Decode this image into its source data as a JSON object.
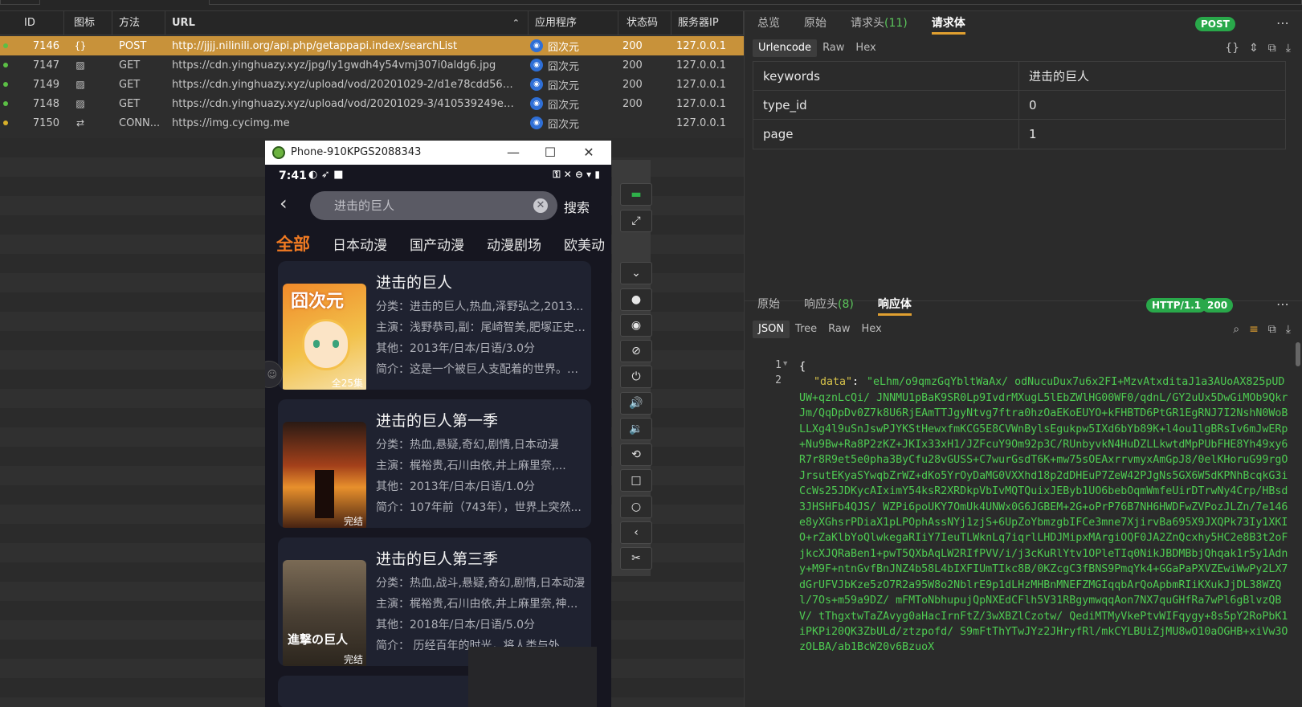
{
  "list": {
    "columns": [
      "ID",
      "图标",
      "方法",
      "URL",
      "应用程序",
      "状态码",
      "服务器IP"
    ],
    "rows": [
      {
        "id": "7146",
        "icon": "{}",
        "method": "POST",
        "url": "http://jjjj.nilinili.org/api.php/getappapi.index/searchList",
        "app": "囧次元",
        "status": "200",
        "ip": "127.0.0.1",
        "dot": "#5bbf45",
        "selected": true
      },
      {
        "id": "7147",
        "icon": "image",
        "method": "GET",
        "url": "https://cdn.yinghuazy.xyz/jpg/ly1gwdh4y54vmj307i0aldg6.jpg",
        "app": "囧次元",
        "status": "200",
        "ip": "127.0.0.1",
        "dot": "#5bbf45"
      },
      {
        "id": "7149",
        "icon": "image",
        "method": "GET",
        "url": "https://cdn.yinghuazy.xyz/upload/vod/20201029-2/d1e78cdd56d65...",
        "app": "囧次元",
        "status": "200",
        "ip": "127.0.0.1",
        "dot": "#5bbf45"
      },
      {
        "id": "7148",
        "icon": "image",
        "method": "GET",
        "url": "https://cdn.yinghuazy.xyz/upload/vod/20201029-3/410539249ec40...",
        "app": "囧次元",
        "status": "200",
        "ip": "127.0.0.1",
        "dot": "#5bbf45"
      },
      {
        "id": "7150",
        "icon": "tunnel",
        "method": "CONN...",
        "url": "https://img.cycimg.me",
        "app": "囧次元",
        "status": "",
        "ip": "127.0.0.1",
        "dot": "#d8b02a"
      }
    ]
  },
  "request": {
    "tabs": [
      "总览",
      "原始",
      "请求头",
      "请求体"
    ],
    "header_count": "(11)",
    "method_badge": "POST",
    "subtabs": [
      "Urlencode",
      "Raw",
      "Hex"
    ],
    "params": [
      {
        "key": "keywords",
        "value": "进击的巨人"
      },
      {
        "key": "type_id",
        "value": "0"
      },
      {
        "key": "page",
        "value": "1"
      }
    ]
  },
  "response": {
    "tabs": [
      "原始",
      "响应头",
      "响应体"
    ],
    "header_count": "(8)",
    "http_badge": "HTTP/1.1",
    "status_badge": "200",
    "subtabs": [
      "JSON",
      "Tree",
      "Raw",
      "Hex"
    ],
    "line1": "1",
    "line2": "2",
    "brace": "{",
    "data_key": "\"data\"",
    "data_value": "\"eLhm/o9qmzGqYbltWaAx/ odNucuDux7u6x2FI+MzvAtxditaJ1a3AUoAX825pUDUW+qznLcQi/ JNNMU1pBaK9SR0Lp9IvdrMXugL5lEbZWlHG00WF0/qdnL/GY2uUx5DwGiMOb9QkrJm/QqDpDv0Z7k8U6RjEAmTTJgyNtvg7ftra0hzOaEKoEUYO+kFHBTD6PtGR1EgRNJ7I2NshN0WoBLLXg4l9uSnJswPJYKStHewxfmKCG5E8CVWnBylsEgukpw5IXd6bYb89K+l4ou1lgBRsIv6mJwERp+Nu9Bw+Ra8P2zKZ+JKIx33xH1/JZFcuY9Om92p3C/RUnbyvkN4HuDZLLkwtdMpPUbFHE8Yh49xy6R7r8R9et5e0pha3ByCfu28vGUSS+C7wurGsdT6K+mw75sOEAxrrvmyxAmGpJ8/0elKHoruG99rgOJrsutEKyaSYwqbZrWZ+dKo5YrOyDaMG0VXXhd18p2dDHEuP7ZeW42PJgNs5GX6W5dKPNhBcqkG3iCcWs25JDKycAIximY54ksR2XRDkpVbIvMQTQuixJEByb1UO6bebOqmWmfeUirDTrwNy4Crp/HBsd3JHSHFb4QJS/ WZPi6poUKY7OmUk4UNWx0G6JGBEM+2G+oPrP76B7NH6HWDFwZVPozJLZn/7e146e8yXGhsrPDiaX1pLPOphAssNYj1zjS+6UpZoYbmzgbIFCe3mne7XjirvBa695X9JXQPk73Iy1XKIO+rZaKlbYoQlwkegaRIiY7IeuTLWknLq7iqrlLHDJMipxMArgiOQF0JA2ZnQcxhy5HC2e8B3t2oFjkcXJQRaBen1+pwT5QXbAqLW2RIfPVV/i/j3cKuRlYtv1OPleTIq0NikJBDMBbjQhqak1r5y1Adny+M9F+ntnGvfBnJNZ4b58L4bIXFIUmTIkc8B/0KZcgC3fBNS9PmqYk4+GGaPaPXVZEwiWwPy2LX7dGrUFVJbKze5zO7R2a95W8o2NblrE9p1dLHzMHBnMNEFZMGIqqbArQoApbmRIiKXukJjDL38WZQl/7Os+m59a9DZ/ mFMToNbhupujQpNXEdCFlh5V31RBgymwqqAon7NX7quGHfRa7wPl6gBlvzQBV/ tThgxtwTaZAvyg0aHacIrnFtZ/3wXBZlCzotw/ QediMTMyVkePtvWIFqygy+8s5pY2RoPbK1iPKPi20QK3ZbULd/ztzpofd/ S9mFtThYTwJYz2JHryfRl/mkCYLBUiZjMU8wO10aOGHB+xiVw3OzOLBA/ab1BcW20v6BzuoX"
  },
  "phone": {
    "window_title": "Phone-910KPGS2088343",
    "time": "7:41",
    "search_value": "进击的巨人",
    "search_button": "搜索",
    "categories": [
      "全部",
      "日本动漫",
      "国产动漫",
      "动漫剧场",
      "欧美动"
    ],
    "cards": [
      {
        "title": "进击的巨人",
        "category": "分类：进击的巨人,热血,泽野弘之,2013...",
        "cast": "主演：浅野恭司,副：尾崎智美,肥塚正史,...",
        "other": "其他：2013年/日本/日语/3.0分",
        "intro": "简介：这是一个被巨人支配着的世界。成...",
        "tag": "全25集",
        "poster_text": "囧次元"
      },
      {
        "title": "进击的巨人第一季",
        "category": "分类：热血,悬疑,奇幻,剧情,日本动漫",
        "cast": "主演：梶裕贵,石川由依,井上麻里奈,...",
        "other": "其他：2013年/日本/日语/1.0分",
        "intro": "简介：107年前（743年），世界上突然...",
        "tag": "完结",
        "poster_text": ""
      },
      {
        "title": "进击的巨人第三季",
        "category": "分类：热血,战斗,悬疑,奇幻,剧情,日本动漫",
        "cast": "主演：梶裕贵,石川由依,井上麻里奈,神谷...",
        "other": "其他：2018年/日本/日语/5.0分",
        "intro": "简介：      历经百年的时光，将人类与外...",
        "tag": "完结",
        "poster_text": "進撃の巨人"
      }
    ]
  }
}
